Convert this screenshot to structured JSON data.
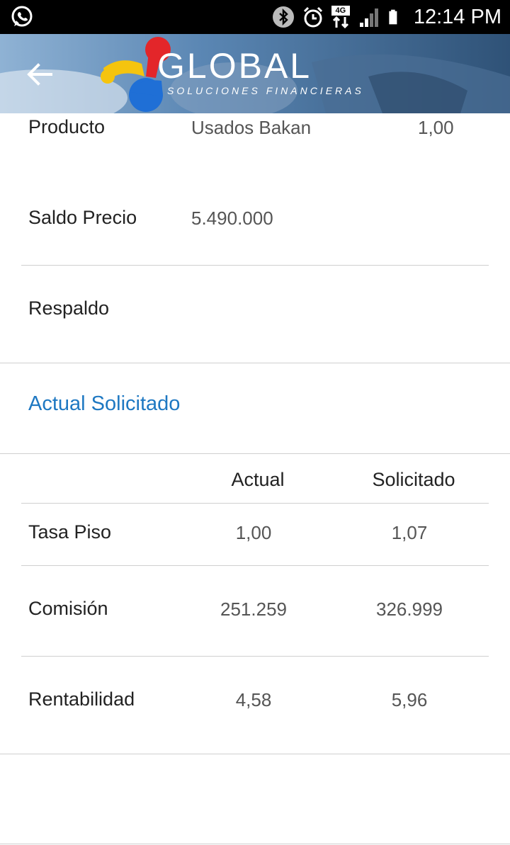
{
  "status_bar": {
    "time": "12:14 PM",
    "network": "4G"
  },
  "header": {
    "brand": "GLOBAL",
    "tagline": "SOLUCIONES FINANCIERAS"
  },
  "details": {
    "producto": {
      "label": "Producto",
      "value": "Usados Bakan",
      "extra": "1,00"
    },
    "saldo_precio": {
      "label": "Saldo Precio",
      "value": "5.490.000"
    },
    "respaldo": {
      "label": "Respaldo"
    }
  },
  "comparison": {
    "title": "Actual Solicitado",
    "columns": [
      "Actual",
      "Solicitado"
    ],
    "rows": [
      {
        "label": "Tasa Piso",
        "actual": "1,00",
        "solicitado": "1,07"
      },
      {
        "label": "Comisión",
        "actual": "251.259",
        "solicitado": "326.999"
      },
      {
        "label": "Rentabilidad",
        "actual": "4,58",
        "solicitado": "5,96"
      }
    ]
  },
  "colors": {
    "accent": "#1e78c2",
    "status_bar": "#000000",
    "divider": "#cfcfcf"
  }
}
